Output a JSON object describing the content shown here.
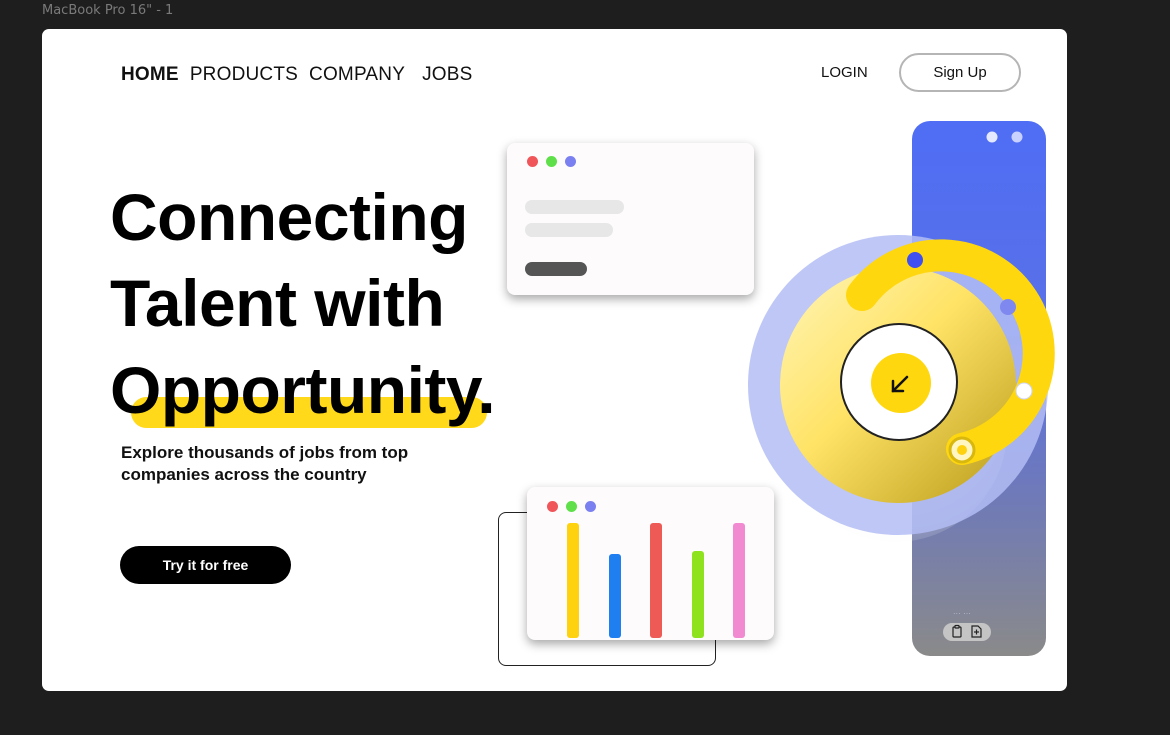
{
  "frame": {
    "label": "MacBook Pro 16\" - 1"
  },
  "nav": {
    "items": [
      {
        "label": "HOME"
      },
      {
        "label": "PRODUCTS"
      },
      {
        "label": "COMPANY"
      },
      {
        "label": "JOBS"
      }
    ],
    "login_label": "LOGIN",
    "signup_label": "Sign Up"
  },
  "hero": {
    "line1": "Connecting",
    "line2": "Talent with",
    "line3": "Opportunity.",
    "subtitle": "Explore thousands of jobs from top companies across the country",
    "cta_label": "Try it for free"
  },
  "colors": {
    "accent_yellow": "#ffd91a",
    "accent_blue": "#4f6ef5",
    "dot_red": "#f0555a",
    "dot_green": "#5fe04a",
    "dot_purple": "#7b80f0"
  },
  "bar_card": {
    "bars": [
      {
        "color": "#ffd20f",
        "value": 1.0
      },
      {
        "color": "#1f7ef0",
        "value": 0.73
      },
      {
        "color": "#ee5a55",
        "value": 1.0
      },
      {
        "color": "#8ee21e",
        "value": 0.76
      },
      {
        "color": "#f28ad2",
        "value": 1.0
      }
    ]
  },
  "dial": {
    "icon": "arrow-down-left-icon"
  },
  "phone": {
    "icons": [
      "clipboard-icon",
      "file-plus-icon"
    ]
  }
}
